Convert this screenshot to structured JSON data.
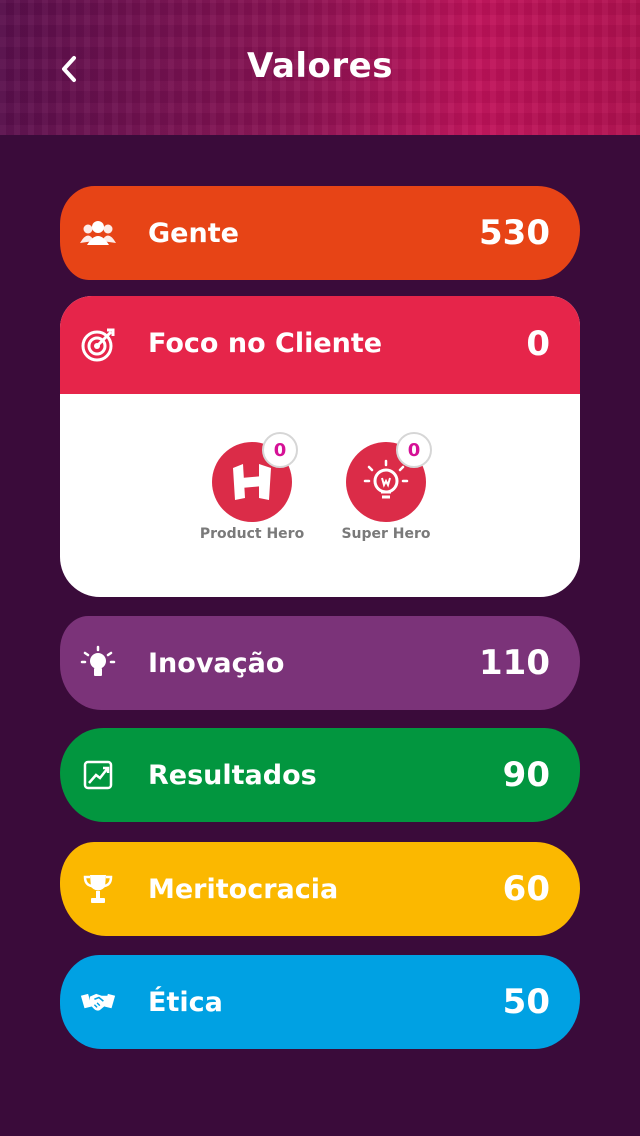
{
  "header": {
    "title": "Valores"
  },
  "values": [
    {
      "label": "Gente",
      "value": "530",
      "icon": "people-icon",
      "color": "#e74416"
    },
    {
      "label": "Foco no Cliente",
      "value": "0",
      "icon": "target-icon",
      "color": "#e6254a"
    },
    {
      "label": "Inovação",
      "value": "110",
      "icon": "lightbulb-icon",
      "color": "#7b3379"
    },
    {
      "label": "Resultados",
      "value": "90",
      "icon": "chart-icon",
      "color": "#02963f"
    },
    {
      "label": "Meritocracia",
      "value": "60",
      "icon": "trophy-icon",
      "color": "#fbb800"
    },
    {
      "label": "Ética",
      "value": "50",
      "icon": "handshake-icon",
      "color": "#00a1e3"
    }
  ],
  "badges": [
    {
      "label": "Product Hero",
      "count": "0",
      "icon": "hero-logo-icon"
    },
    {
      "label": "Super Hero",
      "count": "0",
      "icon": "idea-hero-icon"
    }
  ]
}
